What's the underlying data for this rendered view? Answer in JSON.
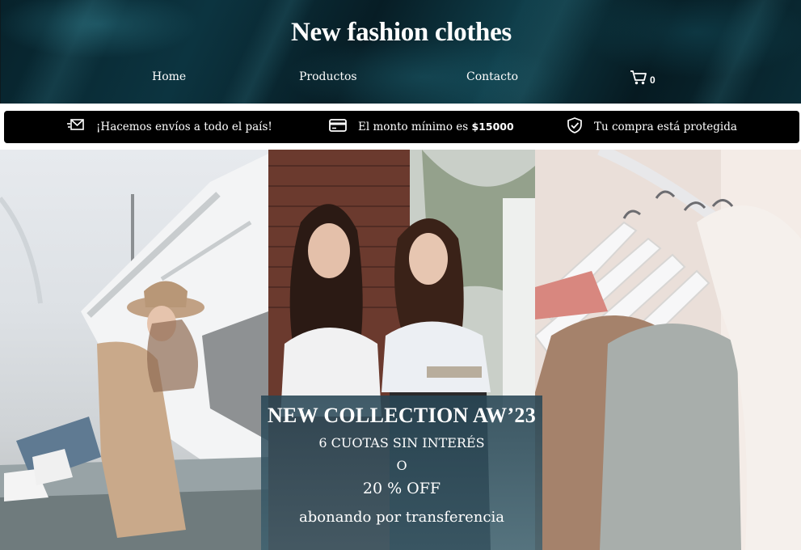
{
  "header": {
    "title": "New fashion clothes",
    "nav": {
      "home": "Home",
      "products": "Productos",
      "contact": "Contacto"
    },
    "cart_count": "0"
  },
  "info_bar": {
    "shipping": "¡Hacemos envíos a todo el país!",
    "minimum_prefix": "El monto mínimo es ",
    "minimum_amount": "$15000",
    "protected": "Tu compra está protegida"
  },
  "banner": {
    "title": "NEW COLLECTION AW’23",
    "installments": "6 CUOTAS SIN INTERÉS",
    "or": "O",
    "discount": "20 % OFF",
    "transfer": "abonando por transferencia"
  },
  "icons": {
    "shipping": "shipping-mail-icon",
    "payment": "credit-card-icon",
    "protection": "shield-check-icon",
    "cart": "shopping-cart-icon"
  },
  "colors": {
    "info_bar_bg": "#000000",
    "header_bg": "#0a2c36",
    "promo_overlay": "#2e5566"
  }
}
